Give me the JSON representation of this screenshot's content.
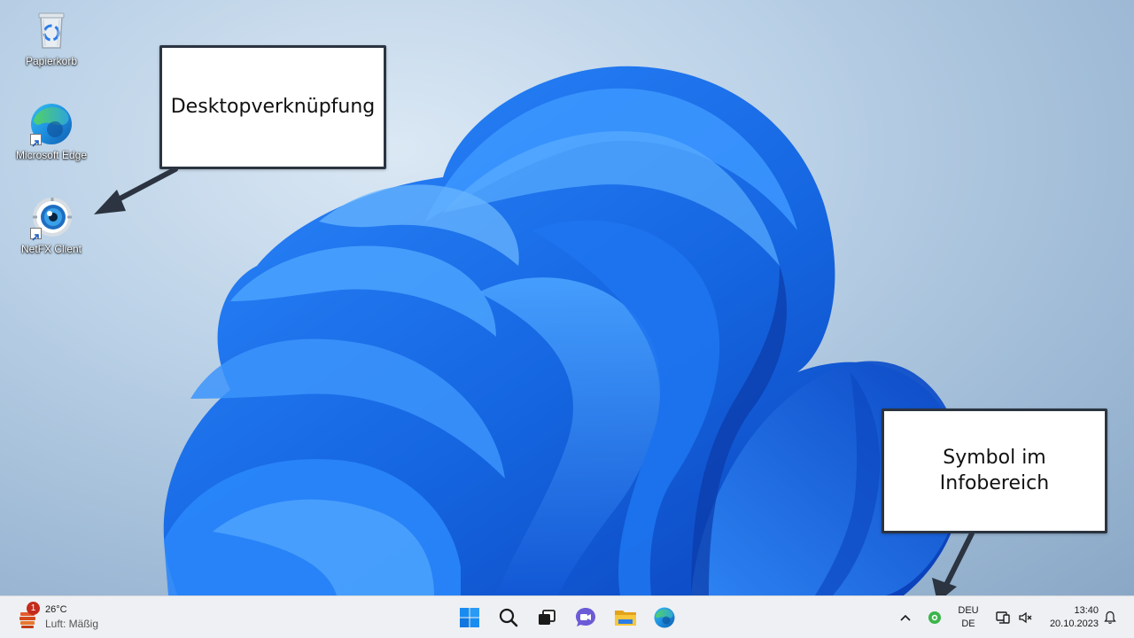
{
  "desktop": {
    "icons": [
      {
        "label": "Papierkorb",
        "icon": "recycle-bin-icon"
      },
      {
        "label": "Microsoft Edge",
        "icon": "edge-icon"
      },
      {
        "label": "NetFX Client",
        "icon": "netfx-eye-icon"
      }
    ],
    "callouts": {
      "shortcut": "Desktopverknüpfung",
      "tray_line1": "Symbol im",
      "tray_line2": "Infobereich"
    }
  },
  "taskbar": {
    "weather": {
      "badge": "1",
      "temp": "26°C",
      "condition": "Luft: Mäßig",
      "icon": "weather-app-icon"
    },
    "apps": [
      {
        "name": "start",
        "icon": "windows-start-icon"
      },
      {
        "name": "search",
        "icon": "search-icon"
      },
      {
        "name": "task-view",
        "icon": "task-view-icon"
      },
      {
        "name": "chat",
        "icon": "teams-chat-icon"
      },
      {
        "name": "file-explorer",
        "icon": "folder-icon"
      },
      {
        "name": "edge",
        "icon": "edge-icon"
      }
    ],
    "tray": {
      "lang_line1": "DEU",
      "lang_line2": "DE",
      "time": "13:40",
      "date": "20.10.2023"
    }
  },
  "colors": {
    "taskbar_bg": "#eef0f3",
    "wallpaper_blue": "#1565e0",
    "callout_border": "#2b3440",
    "tray_green": "#3bb54a"
  }
}
